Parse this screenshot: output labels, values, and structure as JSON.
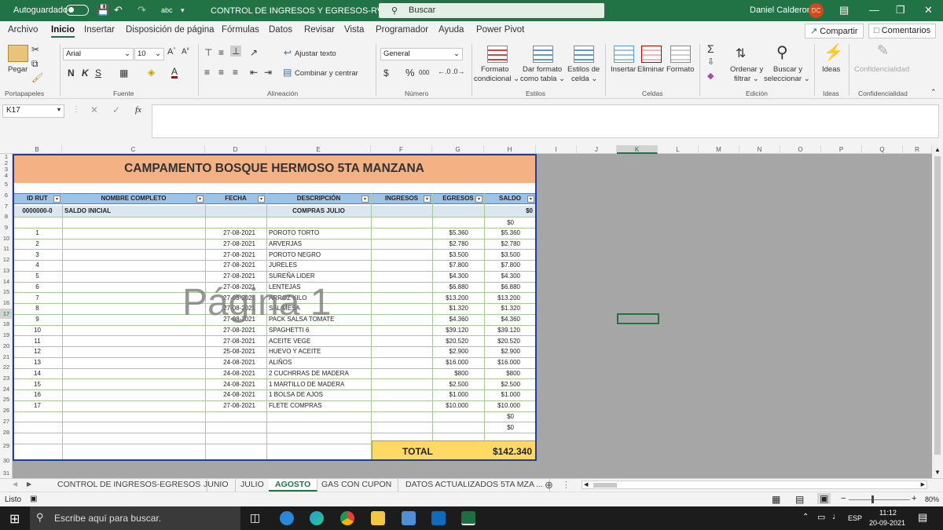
{
  "titlebar": {
    "autosave_label": "Autoguardado",
    "doc_title": "CONTROL DE INGRESOS Y EGRESOS-RV01",
    "search_placeholder": "Buscar",
    "user_name": "Daniel Calderon",
    "user_initials": "DC"
  },
  "menu": {
    "items": [
      "Archivo",
      "Inicio",
      "Insertar",
      "Disposición de página",
      "Fórmulas",
      "Datos",
      "Revisar",
      "Vista",
      "Programador",
      "Ayuda",
      "Power Pivot"
    ],
    "active": "Inicio",
    "share": "Compartir",
    "comments": "Comentarios"
  },
  "ribbon": {
    "paste": "Pegar",
    "font_name": "Arial",
    "font_size": "10",
    "bold": "N",
    "italic": "K",
    "underline": "S",
    "wrap_text": "Ajustar texto",
    "merge_center": "Combinar y centrar",
    "number_format": "General",
    "currency": "$",
    "percent": "%",
    "thousands": "000",
    "cond_format_1": "Formato",
    "cond_format_2": "condicional",
    "table_format_1": "Dar formato",
    "table_format_2": "como tabla",
    "cell_styles_1": "Estilos de",
    "cell_styles_2": "celda",
    "insert": "Insertar",
    "delete": "Eliminar",
    "format": "Formato",
    "sort_1": "Ordenar y",
    "sort_2": "filtrar",
    "find_1": "Buscar y",
    "find_2": "seleccionar",
    "ideas": "Ideas",
    "confidentiality": "Confidencialidad",
    "groups": {
      "clipboard": "Portapapeles",
      "font": "Fuente",
      "alignment": "Alineación",
      "number": "Número",
      "styles": "Estilos",
      "cells": "Celdas",
      "editing": "Edición",
      "ideas": "Ideas",
      "confidentiality": "Confidencialidad"
    }
  },
  "formula_bar": {
    "name_box": "K17",
    "fx": "fx"
  },
  "columns": [
    "B",
    "C",
    "D",
    "E",
    "F",
    "G",
    "H",
    "I",
    "J",
    "K",
    "L",
    "M",
    "N",
    "O",
    "P",
    "Q",
    "R"
  ],
  "rows": [
    "1",
    "2",
    "3",
    "4",
    "5",
    "6",
    "7",
    "8",
    "9",
    "10",
    "11",
    "12",
    "13",
    "14",
    "15",
    "16",
    "17",
    "18",
    "19",
    "20",
    "21",
    "22",
    "23",
    "24",
    "25",
    "26",
    "27",
    "28",
    "29",
    "30",
    "31"
  ],
  "sheet": {
    "title": "CAMPAMENTO BOSQUE HERMOSO 5TA MANZANA",
    "headers": [
      "ID RUT",
      "NOMBRE COMPLETO",
      "FECHA",
      "DESCRIPCIÓN",
      "INGRESOS",
      "EGRESOS",
      "SALDO"
    ],
    "initial_row": {
      "id": "0000000-0",
      "name": "SALDO INICIAL",
      "desc": "COMPRAS JULIO",
      "saldo": "$0"
    },
    "row8_saldo": "$0",
    "entries": [
      {
        "id": "1",
        "fecha": "27-08-2021",
        "desc": "POROTO TORTO",
        "egreso": "$5.360",
        "saldo": "$5.360"
      },
      {
        "id": "2",
        "fecha": "27-08-2021",
        "desc": "ARVERJAS",
        "egreso": "$2.780",
        "saldo": "$2.780"
      },
      {
        "id": "3",
        "fecha": "27-08-2021",
        "desc": "POROTO NEGRO",
        "egreso": "$3.500",
        "saldo": "$3.500"
      },
      {
        "id": "4",
        "fecha": "27-08-2021",
        "desc": "JURELES",
        "egreso": "$7.800",
        "saldo": "$7.800"
      },
      {
        "id": "5",
        "fecha": "27-08-2021",
        "desc": "SUREÑA LIDER",
        "egreso": "$4.300",
        "saldo": "$4.300"
      },
      {
        "id": "6",
        "fecha": "27-08-2021",
        "desc": "LENTEJAS",
        "egreso": "$6.880",
        "saldo": "$6.880"
      },
      {
        "id": "7",
        "fecha": "27-08-2021",
        "desc": "ARROZ KILO",
        "egreso": "$13.200",
        "saldo": "$13.200"
      },
      {
        "id": "8",
        "fecha": "27-08-2021",
        "desc": "SAL MESA",
        "egreso": "$1.320",
        "saldo": "$1.320"
      },
      {
        "id": "9",
        "fecha": "27-08-2021",
        "desc": "PACK SALSA TOMATE",
        "egreso": "$4.360",
        "saldo": "$4.360"
      },
      {
        "id": "10",
        "fecha": "27-08-2021",
        "desc": "SPAGHETTI 6",
        "egreso": "$39.120",
        "saldo": "$39.120"
      },
      {
        "id": "11",
        "fecha": "27-08-2021",
        "desc": "ACEITE VEGE",
        "egreso": "$20.520",
        "saldo": "$20.520"
      },
      {
        "id": "12",
        "fecha": "25-08-2021",
        "desc": "HUEVO Y ACEITE",
        "egreso": "$2.900",
        "saldo": "$2.900"
      },
      {
        "id": "13",
        "fecha": "24-08-2021",
        "desc": "ALIÑOS",
        "egreso": "$16.000",
        "saldo": "$16.000"
      },
      {
        "id": "14",
        "fecha": "24-08-2021",
        "desc": "2 CUCHRRAS DE MADERA",
        "egreso": "$800",
        "saldo": "$800"
      },
      {
        "id": "15",
        "fecha": "24-08-2021",
        "desc": "1 MARTILLO DE MADERA",
        "egreso": "$2.500",
        "saldo": "$2.500"
      },
      {
        "id": "16",
        "fecha": "24-08-2021",
        "desc": "1 BOLSA DE AJOS",
        "egreso": "$1.000",
        "saldo": "$1.000"
      },
      {
        "id": "17",
        "fecha": "27-08-2021",
        "desc": "FLETE COMPRAS",
        "egreso": "$10.000",
        "saldo": "$10.000"
      }
    ],
    "row26_saldo": "$0",
    "row27_saldo": "$0",
    "total_label": "TOTAL",
    "total_value": "$142.340",
    "page_watermark": "Página 1"
  },
  "tabs": {
    "items": [
      "CONTROL DE INGRESOS-EGRESOS",
      "JUNIO",
      "JULIO",
      "AGOSTO",
      "GAS CON CUPON",
      "DATOS ACTUALIZADOS 5TA MZA ..."
    ],
    "active": "AGOSTO"
  },
  "status": {
    "ready": "Listo",
    "zoom": "80%"
  },
  "taskbar": {
    "search_placeholder": "Escribe aquí para buscar.",
    "lang": "ESP",
    "time": "11:12",
    "date": "20-09-2021"
  },
  "colors": {
    "excel_green": "#217346",
    "banner": "#f4b183",
    "header_blue": "#9dc3e6",
    "total_yellow": "#ffd966",
    "frame_blue": "#1f3d99"
  }
}
